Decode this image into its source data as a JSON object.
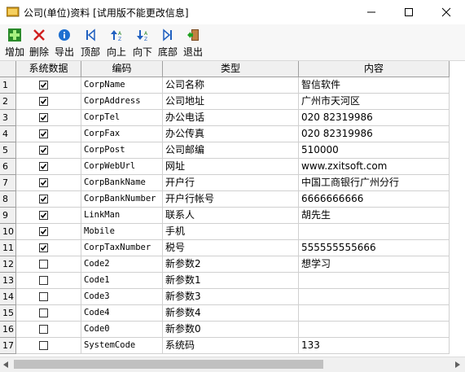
{
  "window": {
    "title": "公司(单位)资料  [试用版不能更改信息]"
  },
  "toolbar": {
    "items": [
      {
        "label": "增加",
        "icon": "add-green-cross-icon"
      },
      {
        "label": "删除",
        "icon": "delete-red-x-icon"
      },
      {
        "label": "导出",
        "icon": "export-info-icon"
      },
      {
        "label": "顶部",
        "icon": "first-record-icon"
      },
      {
        "label": "向上",
        "icon": "move-up-icon"
      },
      {
        "label": "向下",
        "icon": "move-down-icon"
      },
      {
        "label": "底部",
        "icon": "last-record-icon"
      },
      {
        "label": "退出",
        "icon": "exit-door-icon"
      }
    ]
  },
  "grid": {
    "columns": [
      "系统数据",
      "编码",
      "类型",
      "内容"
    ],
    "rows": [
      {
        "no": "1",
        "system": true,
        "code": "CorpName",
        "type": "公司名称",
        "content": "智信软件"
      },
      {
        "no": "2",
        "system": true,
        "code": "CorpAddress",
        "type": "公司地址",
        "content": "广州市天河区"
      },
      {
        "no": "3",
        "system": true,
        "code": "CorpTel",
        "type": "办公电话",
        "content": "020 82319986"
      },
      {
        "no": "4",
        "system": true,
        "code": "CorpFax",
        "type": "办公传真",
        "content": "020 82319986"
      },
      {
        "no": "5",
        "system": true,
        "code": "CorpPost",
        "type": "公司邮编",
        "content": "510000"
      },
      {
        "no": "6",
        "system": true,
        "code": "CorpWebUrl",
        "type": "网址",
        "content": "www.zxitsoft.com"
      },
      {
        "no": "7",
        "system": true,
        "code": "CorpBankName",
        "type": "开户行",
        "content": "中国工商银行广州分行"
      },
      {
        "no": "8",
        "system": true,
        "code": "CorpBankNumber",
        "type": "开户行帐号",
        "content": "6666666666"
      },
      {
        "no": "9",
        "system": true,
        "code": "LinkMan",
        "type": "联系人",
        "content": "胡先生"
      },
      {
        "no": "10",
        "system": true,
        "code": "Mobile",
        "type": "手机",
        "content": ""
      },
      {
        "no": "11",
        "system": true,
        "code": "CorpTaxNumber",
        "type": "税号",
        "content": "555555555666"
      },
      {
        "no": "12",
        "system": false,
        "code": "Code2",
        "type": "新参数2",
        "content": "想学习"
      },
      {
        "no": "13",
        "system": false,
        "code": "Code1",
        "type": "新参数1",
        "content": ""
      },
      {
        "no": "14",
        "system": false,
        "code": "Code3",
        "type": "新参数3",
        "content": ""
      },
      {
        "no": "15",
        "system": false,
        "code": "Code4",
        "type": "新参数4",
        "content": ""
      },
      {
        "no": "16",
        "system": false,
        "code": "Code0",
        "type": "新参数0",
        "content": ""
      },
      {
        "no": "17",
        "system": false,
        "code": "SystemCode",
        "type": "系统码",
        "content": "133"
      }
    ]
  },
  "colors": {
    "header_bg": "#f0f0f0",
    "grid_line": "#d0d0d0",
    "folder_icon": "#d8a020"
  }
}
